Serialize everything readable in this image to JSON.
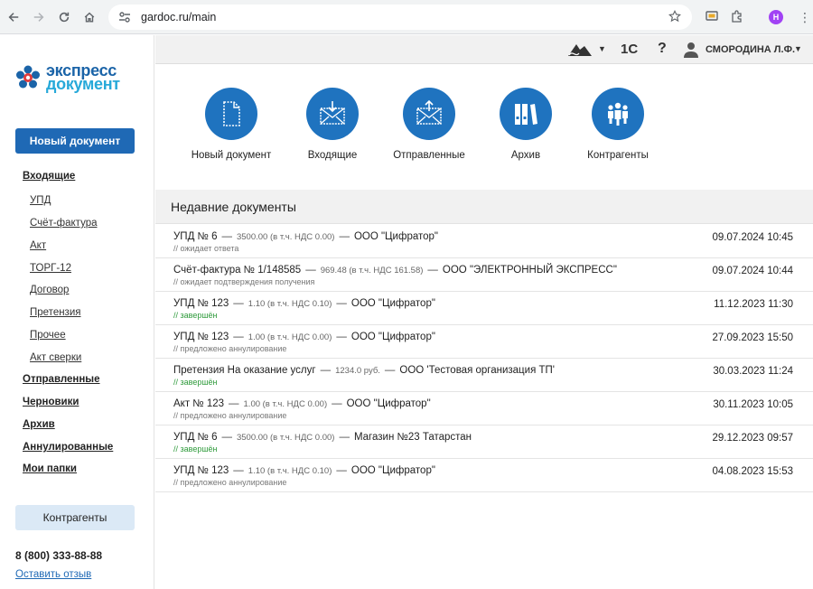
{
  "browser": {
    "url": "gardoc.ru/main",
    "profile_initial": "Н"
  },
  "brand": {
    "line1": "экспресс",
    "line2": "документ",
    "colors": {
      "primary": "#1f69b5",
      "accent": "#27a9d9",
      "done": "#2d9a3a"
    }
  },
  "sidebar": {
    "new_doc_button": "Новый документ",
    "items": [
      {
        "label": "Входящие",
        "kind": "main"
      },
      {
        "label": "УПД",
        "kind": "sub"
      },
      {
        "label": "Счёт-фактура",
        "kind": "sub"
      },
      {
        "label": "Акт",
        "kind": "sub"
      },
      {
        "label": "ТОРГ-12",
        "kind": "sub"
      },
      {
        "label": "Договор",
        "kind": "sub"
      },
      {
        "label": "Претензия",
        "kind": "sub"
      },
      {
        "label": "Прочее",
        "kind": "sub"
      },
      {
        "label": "Акт сверки",
        "kind": "sub"
      },
      {
        "label": "Отправленные",
        "kind": "main"
      },
      {
        "label": "Черновики",
        "kind": "main"
      },
      {
        "label": "Архив",
        "kind": "main"
      },
      {
        "label": "Аннулированные",
        "kind": "main"
      },
      {
        "label": "Мои папки",
        "kind": "main"
      }
    ],
    "contragents_button": "Контрагенты",
    "phone": "8 (800) 333-88-88",
    "feedback_link": "Оставить отзыв"
  },
  "topbar": {
    "onec_label": "1С",
    "help_label": "?",
    "user_name": "СМОРОДИНА Л.Ф."
  },
  "quick_actions": [
    {
      "label": "Новый документ",
      "icon": "new-document-icon"
    },
    {
      "label": "Входящие",
      "icon": "inbox-icon"
    },
    {
      "label": "Отправленные",
      "icon": "outbox-icon"
    },
    {
      "label": "Архив",
      "icon": "archive-icon"
    },
    {
      "label": "Контрагенты",
      "icon": "contragents-icon"
    }
  ],
  "recent": {
    "title": "Недавние документы",
    "documents": [
      {
        "name": "УПД № 6",
        "amount": "3500.00 (в т.ч. НДС 0.00)",
        "counterparty": "ООО \"Цифратор\"",
        "status": "// ожидает ответа",
        "status_done": false,
        "date": "09.07.2024 10:45"
      },
      {
        "name": "Счёт-фактура № 1/148585",
        "amount": "969.48 (в т.ч. НДС 161.58)",
        "counterparty": "ООО \"ЭЛЕКТРОННЫЙ ЭКСПРЕСС\"",
        "status": "// ожидает подтверждения получения",
        "status_done": false,
        "date": "09.07.2024 10:44"
      },
      {
        "name": "УПД № 123",
        "amount": "1.10 (в т.ч. НДС 0.10)",
        "counterparty": "ООО \"Цифратор\"",
        "status": "// завершён",
        "status_done": true,
        "date": "11.12.2023 11:30"
      },
      {
        "name": "УПД № 123",
        "amount": "1.00 (в т.ч. НДС 0.00)",
        "counterparty": "ООО \"Цифратор\"",
        "status": "// предложено аннулирование",
        "status_done": false,
        "date": "27.09.2023 15:50"
      },
      {
        "name": "Претензия На оказание услуг",
        "amount": "1234.0 руб.",
        "counterparty": "ООО 'Тестовая организация ТП'",
        "status": "// завершён",
        "status_done": true,
        "date": "30.03.2023 11:24"
      },
      {
        "name": "Акт № 123",
        "amount": "1.00 (в т.ч. НДС 0.00)",
        "counterparty": "ООО \"Цифратор\"",
        "status": "// предложено аннулирование",
        "status_done": false,
        "date": "30.11.2023 10:05"
      },
      {
        "name": "УПД № 6",
        "amount": "3500.00 (в т.ч. НДС 0.00)",
        "counterparty": "Магазин №23 Татарстан",
        "status": "// завершён",
        "status_done": true,
        "date": "29.12.2023 09:57"
      },
      {
        "name": "УПД № 123",
        "amount": "1.10 (в т.ч. НДС 0.10)",
        "counterparty": "ООО \"Цифратор\"",
        "status": "// предложено аннулирование",
        "status_done": false,
        "date": "04.08.2023 15:53"
      }
    ]
  }
}
